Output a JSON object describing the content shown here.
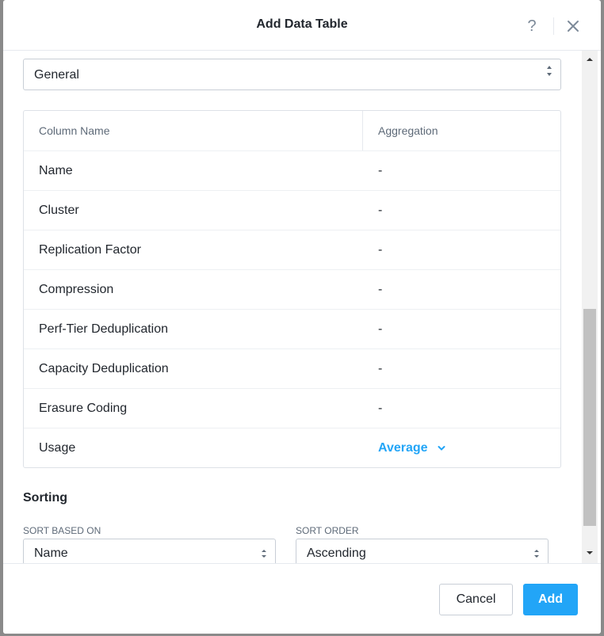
{
  "dialog": {
    "title": "Add Data Table",
    "help_label": "?",
    "view_select": {
      "value": "General"
    },
    "table": {
      "headers": {
        "name": "Column Name",
        "aggregation": "Aggregation"
      },
      "rows": [
        {
          "name": "Name",
          "aggregation": "-"
        },
        {
          "name": "Cluster",
          "aggregation": "-"
        },
        {
          "name": "Replication Factor",
          "aggregation": "-"
        },
        {
          "name": "Compression",
          "aggregation": "-"
        },
        {
          "name": "Perf-Tier Deduplication",
          "aggregation": "-"
        },
        {
          "name": "Capacity Deduplication",
          "aggregation": "-"
        },
        {
          "name": "Erasure Coding",
          "aggregation": "-"
        },
        {
          "name": "Usage",
          "aggregation": "Average"
        }
      ]
    },
    "sorting": {
      "title": "Sorting",
      "based_on_label": "SORT BASED ON",
      "based_on_value": "Name",
      "order_label": "SORT ORDER",
      "order_value": "Ascending"
    },
    "footer": {
      "cancel_label": "Cancel",
      "add_label": "Add"
    }
  },
  "colors": {
    "accent": "#22a5f7",
    "border": "#c8ced6",
    "text": "#22272e",
    "muted": "#5e6a78"
  },
  "icons": {
    "help": "question-mark-icon",
    "close": "close-icon",
    "select": "sort-arrows-icon",
    "dropdown": "chevron-down-icon"
  }
}
